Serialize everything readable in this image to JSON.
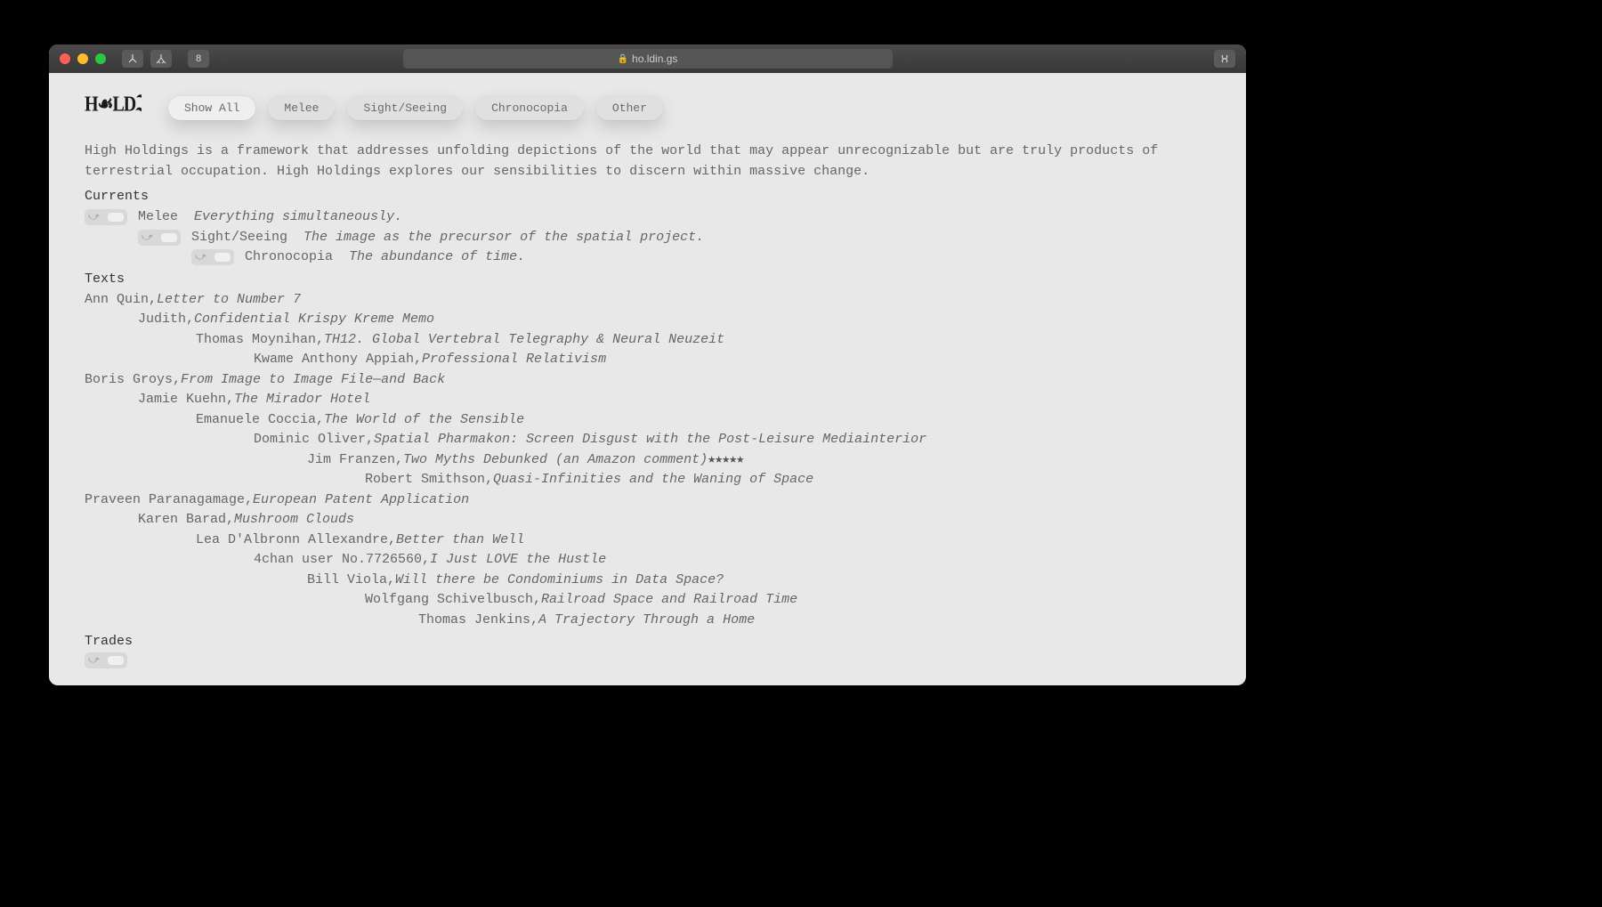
{
  "browser": {
    "url": "ho.ldin.gs"
  },
  "nav": {
    "buttons": [
      {
        "label": "Show All",
        "active": true
      },
      {
        "label": "Melee",
        "active": false
      },
      {
        "label": "Sight/Seeing",
        "active": false
      },
      {
        "label": "Chronocopia",
        "active": false
      },
      {
        "label": "Other",
        "active": false
      }
    ]
  },
  "intro": "High Holdings is a framework that addresses unfolding depictions of the world that may appear unrecognizable but are truly products of terrestrial occupation. High Holdings explores our sensibilities to discern within massive change.",
  "sections": {
    "currents": {
      "title": "Currents",
      "items": [
        {
          "label": "Melee",
          "desc": "Everything simultaneously.",
          "indent": 0
        },
        {
          "label": "Sight/Seeing",
          "desc": "The image as the precursor of the spatial project.",
          "indent": 1
        },
        {
          "label": "Chronocopia",
          "desc": "The abundance of time.",
          "indent": 2
        }
      ]
    },
    "texts": {
      "title": "Texts",
      "items": [
        {
          "author": "Ann Quin",
          "title": "Letter to Number 7",
          "indent": 0
        },
        {
          "author": "Judith",
          "title": "Confidential Krispy Kreme Memo",
          "indent": 60
        },
        {
          "author": "Thomas Moynihan",
          "title": "TH12. Global Vertebral Telegraphy & Neural Neuzeit",
          "indent": 125
        },
        {
          "author": "Kwame Anthony Appiah",
          "title": "Professional Relativism",
          "indent": 190
        },
        {
          "author": "Boris Groys",
          "title": "From Image to Image File—and Back",
          "indent": 0
        },
        {
          "author": "Jamie Kuehn",
          "title": "The Mirador Hotel",
          "indent": 60
        },
        {
          "author": "Emanuele Coccia",
          "title": "The World of the Sensible",
          "indent": 125
        },
        {
          "author": "Dominic Oliver",
          "title": "Spatial Pharmakon: Screen Disgust with the Post-Leisure Mediainterior",
          "indent": 190
        },
        {
          "author": "Jim Franzen",
          "title": "Two Myths Debunked (an Amazon comment)",
          "suffix_stars": "★★★★★",
          "indent": 250
        },
        {
          "author": "Robert Smithson",
          "title": "Quasi-Infinities and the Waning of Space",
          "indent": 315
        },
        {
          "author": "Praveen Paranagamage",
          "title": "European Patent Application",
          "indent": 0
        },
        {
          "author": "Karen Barad",
          "title": "Mushroom Clouds",
          "indent": 60
        },
        {
          "author": "Lea D'Albronn Allexandre",
          "title": "Better than Well",
          "indent": 125
        },
        {
          "author": "4chan user No.7726560",
          "title": "I Just LOVE the Hustle",
          "indent": 190
        },
        {
          "author": "Bill Viola",
          "title": "Will there be Condominiums in Data Space?",
          "indent": 250
        },
        {
          "author": "Wolfgang Schivelbusch",
          "title": "Railroad Space and Railroad Time",
          "indent": 315
        },
        {
          "author": "Thomas Jenkins",
          "title": "A Trajectory Through a Home",
          "indent": 375
        }
      ]
    },
    "trades": {
      "title": "Trades"
    }
  }
}
